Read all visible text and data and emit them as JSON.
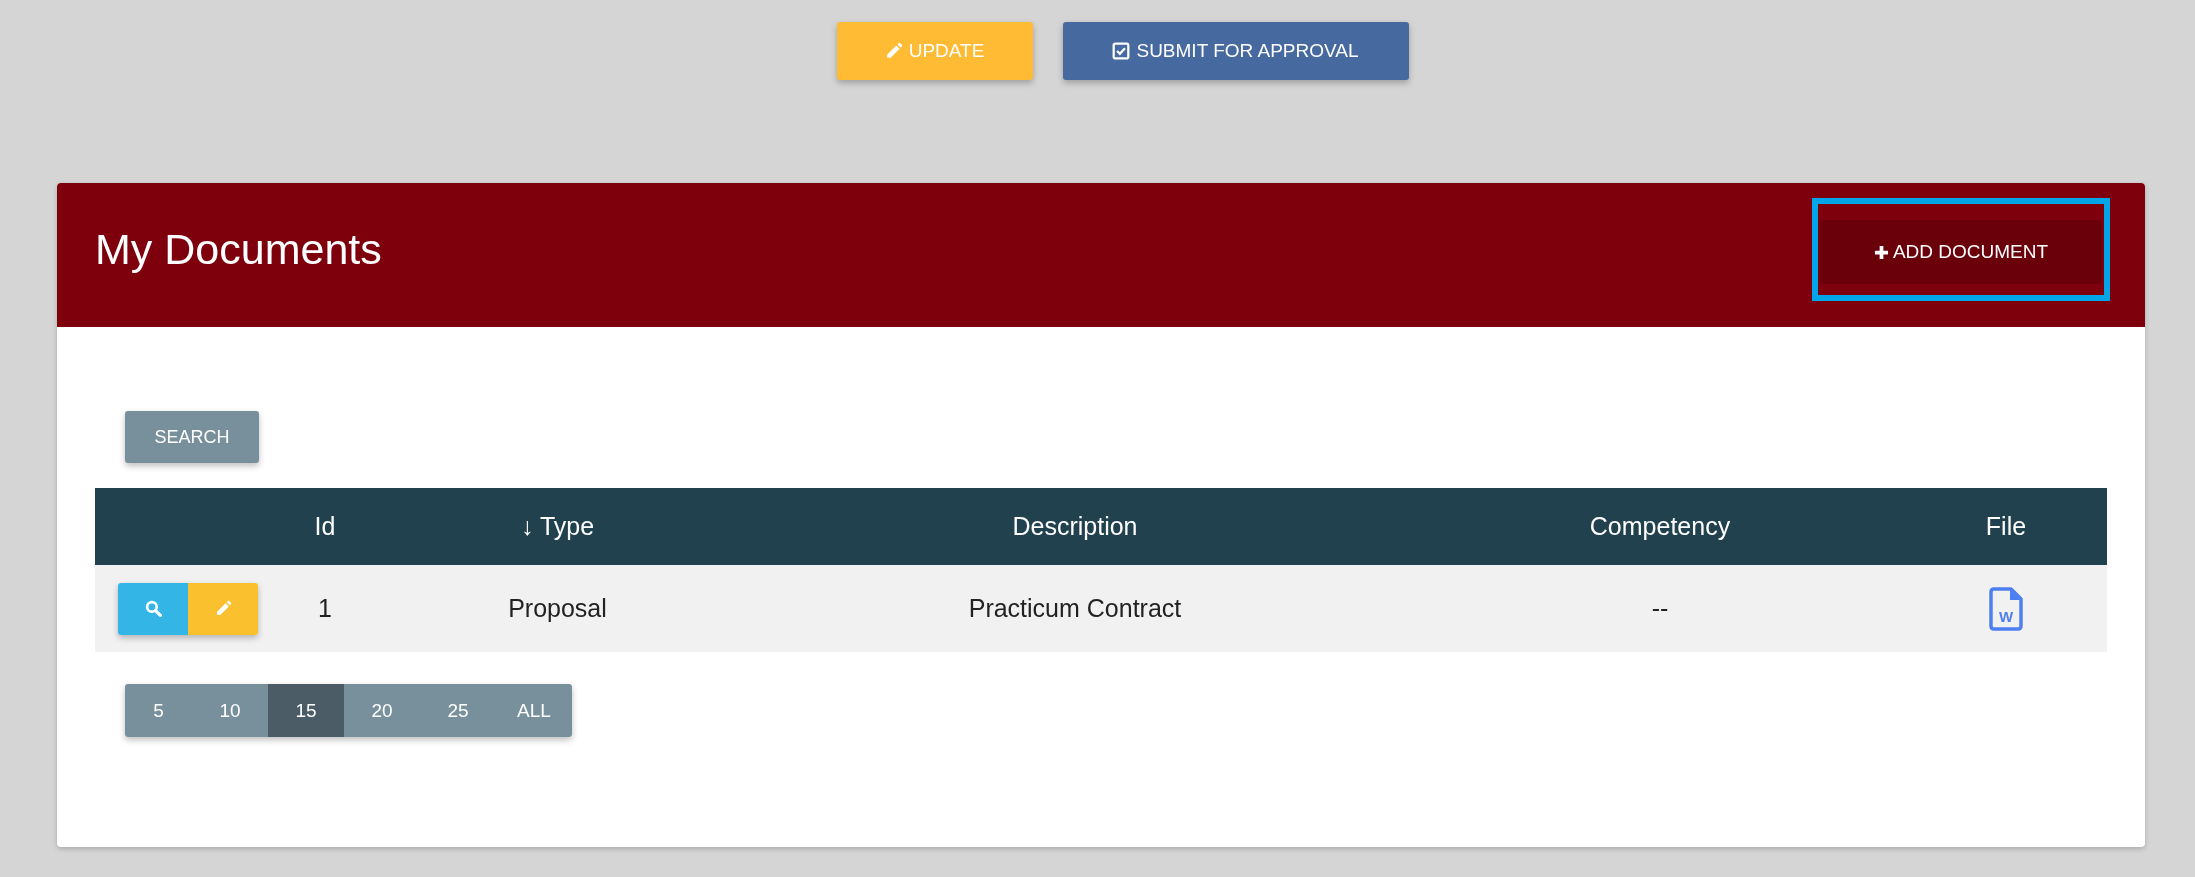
{
  "actions": [
    {
      "kind": "update",
      "label": "UPDATE"
    },
    {
      "kind": "submit",
      "label": "SUBMIT FOR APPROVAL"
    }
  ],
  "panel": {
    "title": "My Documents",
    "add_button": {
      "label": "ADD DOCUMENT",
      "highlighted": true
    },
    "search_button": "SEARCH",
    "table": {
      "columns": [
        {
          "kind": "actions"
        },
        {
          "kind": "text",
          "label": "Id"
        },
        {
          "kind": "text",
          "label": "Type",
          "sort_arrow": "↓"
        },
        {
          "kind": "text",
          "label": "Description"
        },
        {
          "kind": "text",
          "label": "Competency"
        },
        {
          "kind": "text",
          "label": "File"
        }
      ],
      "rows": [
        {
          "id": "1",
          "type": "Proposal",
          "description": "Practicum Contract",
          "competency": "--",
          "file": {
            "kind": "word",
            "letter": "W"
          }
        }
      ]
    },
    "page_sizes": [
      {
        "label": "5",
        "selected": false
      },
      {
        "label": "10",
        "selected": false
      },
      {
        "label": "15",
        "selected": true
      },
      {
        "label": "20",
        "selected": false
      },
      {
        "label": "25",
        "selected": false
      },
      {
        "label": "ALL",
        "selected": false
      }
    ]
  }
}
